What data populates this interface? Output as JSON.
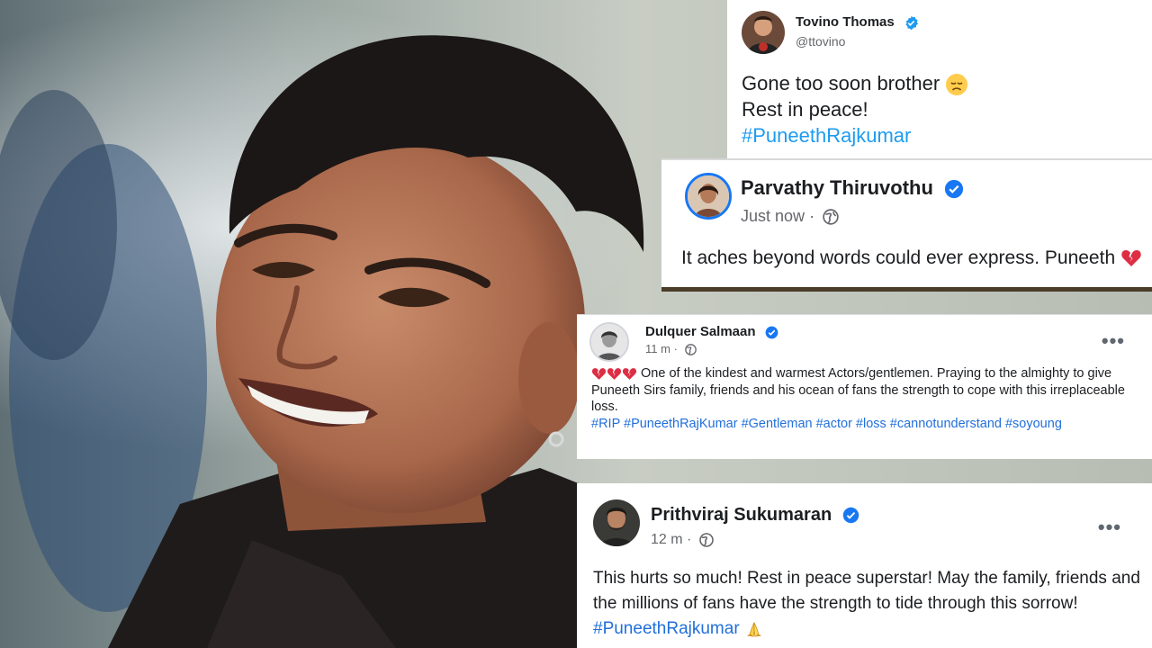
{
  "colors": {
    "twitter_blue": "#1d9bf0",
    "facebook_blue": "#1877f2",
    "hashtag_blue": "#216fdb",
    "verified_badge": "#1d9bf0",
    "broken_heart": "#dd2e44"
  },
  "background": {
    "image": "smiling man portrait",
    "icons": []
  },
  "posts": {
    "tovino": {
      "name": "Tovino Thomas",
      "handle": "@ttovino",
      "line1": "Gone too soon brother",
      "line1_emoji": "disappointed-face-icon",
      "line2": "Rest in peace!",
      "hashtag": "#PuneethRajkumar"
    },
    "parvathy": {
      "name": "Parvathy Thiruvothu",
      "time": "Just now",
      "separator": "·",
      "text": "It aches beyond words could ever express. Puneeth",
      "text_emoji": "broken-heart-icon"
    },
    "dulquer": {
      "name": "Dulquer Salmaan",
      "time": "11 m",
      "separator": "·",
      "more": "•••",
      "text": "One of the kindest and warmest Actors/gentlemen. Praying to the almighty to give Puneeth Sirs family, friends and his ocean of fans the strength to cope with this irreplaceable loss.",
      "leading_emojis": [
        "broken-heart-icon",
        "broken-heart-icon",
        "broken-heart-icon"
      ],
      "hashtags": "#RIP #PuneethRajKumar #Gentleman #actor #loss #cannotunderstand #soyoung"
    },
    "prithviraj": {
      "name": "Prithviraj Sukumaran",
      "time": "12 m",
      "separator": "·",
      "more": "•••",
      "text": "This hurts so much! Rest in peace superstar! May the family, friends and the millions of fans have the strength to tide through this sorrow!",
      "hashtag": "#PuneethRajkumar",
      "hashtag_emoji": "folded-hands-icon"
    }
  }
}
